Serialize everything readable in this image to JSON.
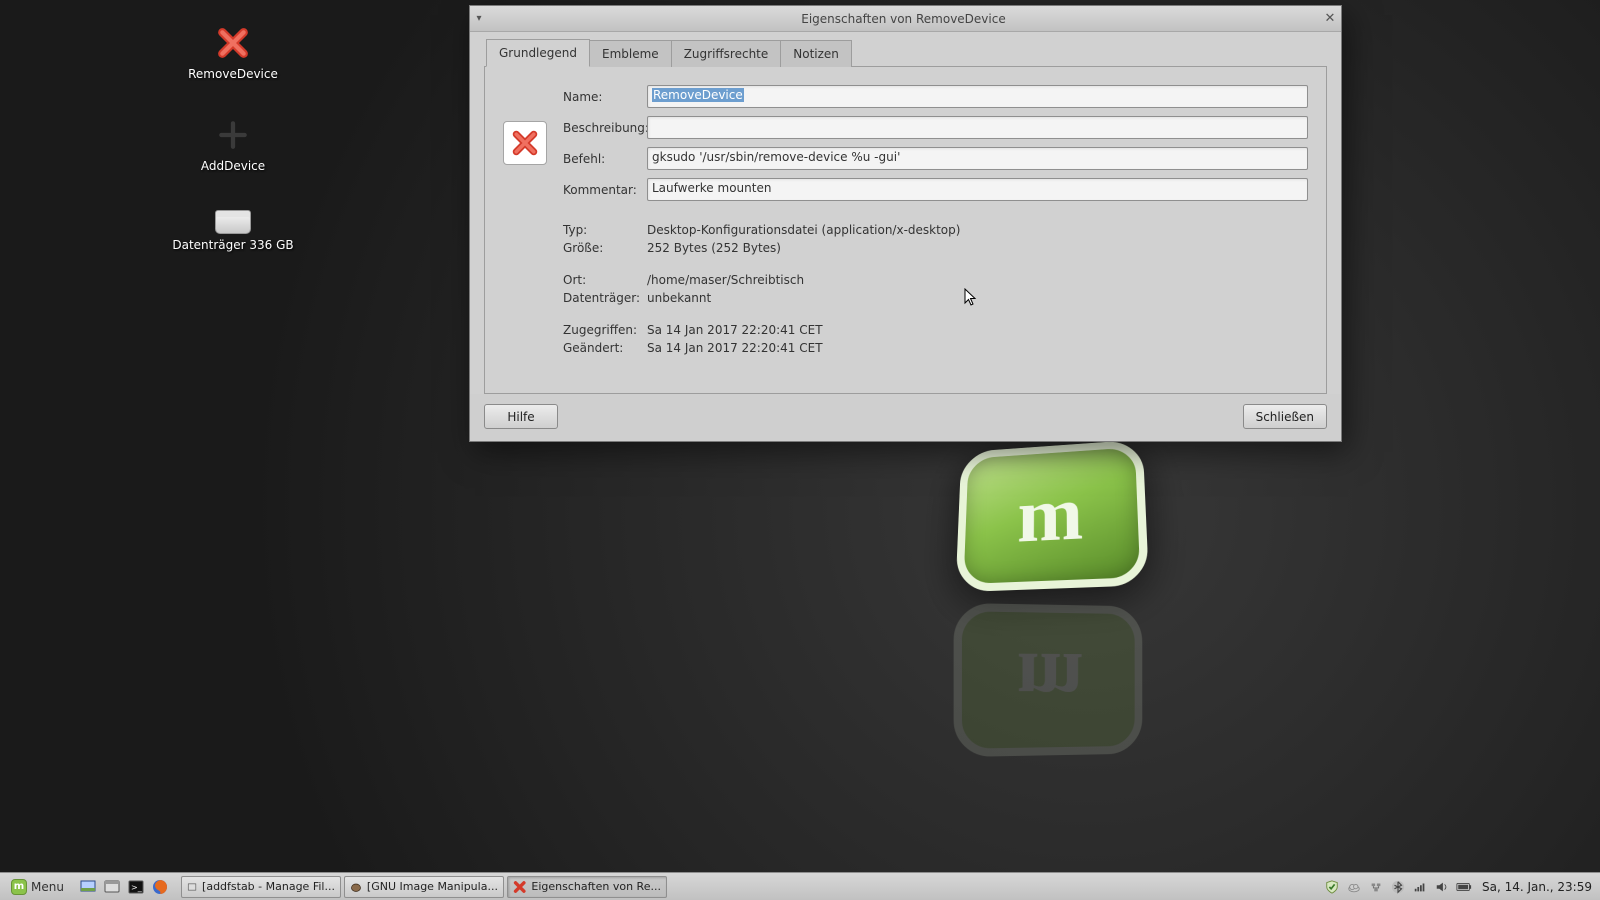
{
  "desktop": {
    "icons": [
      {
        "label": "RemoveDevice"
      },
      {
        "label": "AddDevice"
      },
      {
        "label": "Datenträger 336 GB"
      }
    ]
  },
  "dialog": {
    "title": "Eigenschaften von RemoveDevice",
    "tabs": {
      "basic": "Grundlegend",
      "emblems": "Embleme",
      "perms": "Zugriffsrechte",
      "notes": "Notizen"
    },
    "labels": {
      "name": "Name:",
      "desc": "Beschreibung:",
      "command": "Befehl:",
      "comment": "Kommentar:",
      "type": "Typ:",
      "size": "Größe:",
      "location": "Ort:",
      "volume": "Datenträger:",
      "accessed": "Zugegriffen:",
      "modified": "Geändert:"
    },
    "values": {
      "name": "RemoveDevice",
      "desc": "",
      "command": "gksudo '/usr/sbin/remove-device %u -gui'",
      "comment": "Laufwerke mounten",
      "type": "Desktop-Konfigurationsdatei (application/x-desktop)",
      "size": "252 Bytes (252 Bytes)",
      "location": "/home/maser/Schreibtisch",
      "volume": "unbekannt",
      "accessed": "Sa 14 Jan 2017 22:20:41 CET",
      "modified": "Sa 14 Jan 2017 22:20:41 CET"
    },
    "buttons": {
      "help": "Hilfe",
      "close": "Schließen"
    }
  },
  "taskbar": {
    "menu": "Menu",
    "tasks": [
      {
        "label": "[addfstab - Manage Fil..."
      },
      {
        "label": "[GNU Image Manipula..."
      },
      {
        "label": "Eigenschaften von Re..."
      }
    ],
    "clock": "Sa, 14. Jan., 23:59"
  }
}
